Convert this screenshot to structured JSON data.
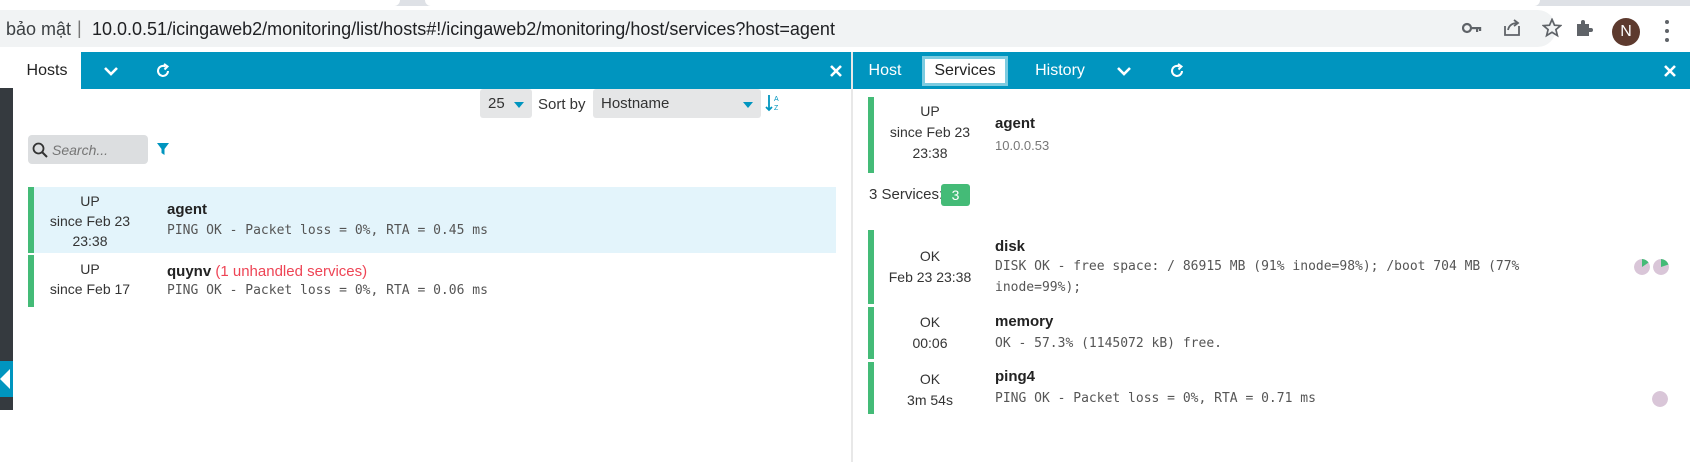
{
  "browser": {
    "security_label": "bảo mật",
    "separator": "|",
    "url": "10.0.0.51/icingaweb2/monitoring/list/hosts#!/icingaweb2/monitoring/host/services?host=agent",
    "avatar_letter": "N",
    "icons": [
      "key-icon",
      "share-icon",
      "star-icon",
      "extensions-icon",
      "more-icon"
    ]
  },
  "left_column": {
    "tab_label": "Hosts",
    "limit": {
      "label": "#",
      "value": "25"
    },
    "sort": {
      "label": "Sort by",
      "value": "Hostname"
    },
    "search": {
      "placeholder": "Search..."
    },
    "hosts": [
      {
        "state": "UP",
        "since": "since Feb 23",
        "time": "23:38",
        "name": "agent",
        "unhandled": "",
        "output": "PING OK - Packet loss = 0%, RTA = 0.45 ms",
        "selected": true
      },
      {
        "state": "UP",
        "since": "since Feb 17",
        "time": "",
        "name": "quynv",
        "unhandled": "(1 unhandled services)",
        "output": "PING OK - Packet loss = 0%, RTA = 0.06 ms",
        "selected": false
      }
    ]
  },
  "right_column": {
    "tabs": [
      "Host",
      "Services",
      "History"
    ],
    "active_tab": "Services",
    "host": {
      "state": "UP",
      "since": "since Feb 23",
      "time": "23:38",
      "name": "agent",
      "address": "10.0.0.53"
    },
    "services_count_label": "3 Services:",
    "services_count": "3",
    "services": [
      {
        "state": "OK",
        "since": "Feb 23 23:38",
        "name": "disk",
        "output_line1": "DISK OK - free space: / 86915 MB (91% inode=98%); /boot 704 MB (77%",
        "output_line2": "inode=99%);"
      },
      {
        "state": "OK",
        "since": "00:06",
        "name": "memory",
        "output_line1": "OK - 57.3% (1145072 kB) free.",
        "output_line2": ""
      },
      {
        "state": "OK",
        "since": "3m 54s",
        "name": "ping4",
        "output_line1": "PING OK - Packet loss = 0%, RTA = 0.71 ms",
        "output_line2": ""
      }
    ]
  },
  "colors": {
    "accent": "#0095bf",
    "ok": "#44bb77",
    "critical": "#ee4455",
    "selected_row": "#e3f4fb"
  }
}
